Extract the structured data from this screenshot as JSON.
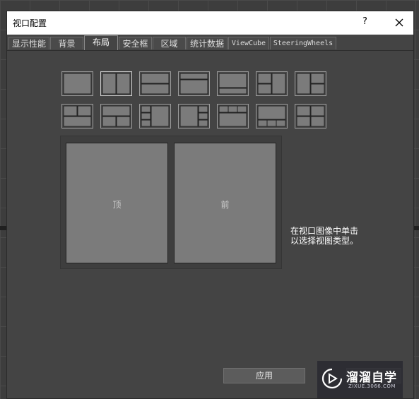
{
  "window": {
    "title": "视口配置",
    "help": "?"
  },
  "tabs": [
    {
      "label": "显示性能",
      "active": false
    },
    {
      "label": "背景",
      "active": false
    },
    {
      "label": "布局",
      "active": true
    },
    {
      "label": "安全框",
      "active": false
    },
    {
      "label": "区域",
      "active": false
    },
    {
      "label": "统计数据",
      "active": false
    },
    {
      "label": "ViewCube",
      "active": false
    },
    {
      "label": "SteeringWheels",
      "active": false
    }
  ],
  "layouts": {
    "selected_index": 1,
    "count": 14
  },
  "preview": {
    "viewports": [
      {
        "label": "顶"
      },
      {
        "label": "前"
      }
    ]
  },
  "hint": {
    "line1": "在视口图像中单击",
    "line2": "以选择视图类型。"
  },
  "buttons": {
    "apply": "应用"
  },
  "watermark": {
    "title": "溜溜自学",
    "subtitle": "ZIXUE.3066.COM"
  },
  "colors": {
    "dialog_bg": "#444444",
    "viewport_fill": "#7b7b7b",
    "titlebar_bg": "#ffffff"
  }
}
